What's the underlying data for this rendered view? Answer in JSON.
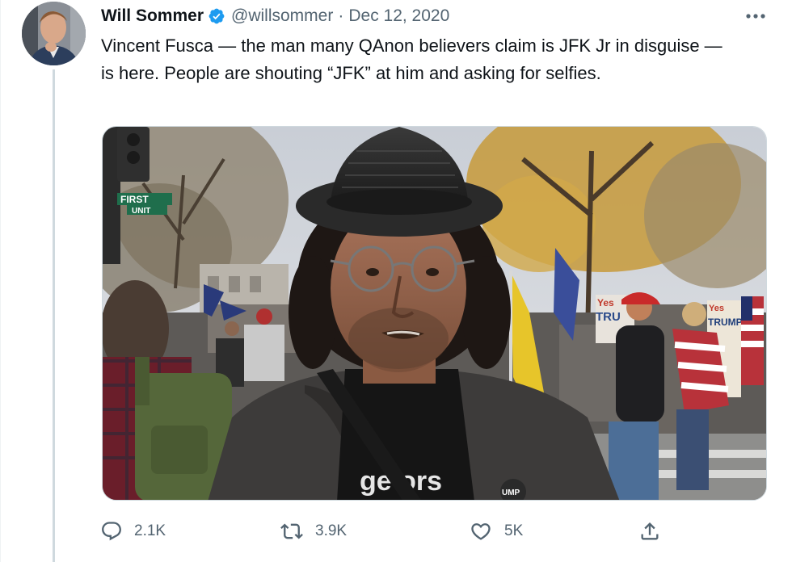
{
  "author": {
    "name": "Will Sommer",
    "handle": "@willsommer",
    "separator": "·",
    "date": "Dec 12, 2020",
    "verified": true
  },
  "tweet": {
    "text": "Vincent Fusca — the man many QAnon believers claim is JFK Jr in disguise — is here. People are shouting “JFK” at him and asking for selfies."
  },
  "media": {
    "signs": {
      "street_top": "FIRST",
      "street_bottom": "UNIT",
      "yes_left": "Yes",
      "tru_left": "TRU",
      "yes_right": "Yes",
      "trump_right": "TRUMP",
      "shirt_text": "ge ors",
      "badge_text": "UMP"
    }
  },
  "actions": {
    "reply_count": "2.1K",
    "retweet_count": "3.9K",
    "like_count": "5K"
  },
  "icons": {
    "verified": "verified-badge-icon",
    "more": "more-icon",
    "reply": "reply-icon",
    "retweet": "retweet-icon",
    "like": "like-icon",
    "share": "share-icon"
  },
  "colors": {
    "verified_blue": "#1d9bf0",
    "secondary_text": "#536471",
    "primary_text": "#0f1419"
  }
}
